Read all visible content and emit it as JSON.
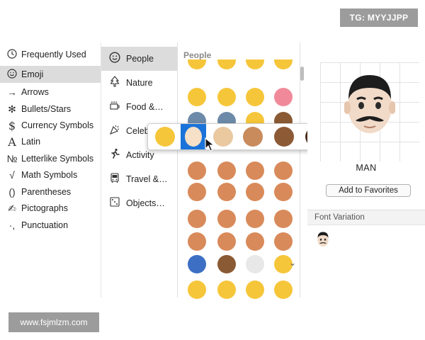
{
  "watermarks": {
    "top": "TG: MYYJJPP",
    "bottom": "www.fsjmlzm.com"
  },
  "categories": [
    {
      "label": "Frequently Used",
      "icon": "clock-icon",
      "glyph": "🕘",
      "selected": false
    },
    {
      "label": "Emoji",
      "icon": "smiley-icon",
      "glyph": "☺",
      "selected": true
    },
    {
      "label": "Arrows",
      "icon": "arrow-icon",
      "glyph": "→",
      "selected": false
    },
    {
      "label": "Bullets/Stars",
      "icon": "asterisk-icon",
      "glyph": "✻",
      "selected": false
    },
    {
      "label": "Currency Symbols",
      "icon": "dollar-icon",
      "glyph": "$",
      "selected": false
    },
    {
      "label": "Latin",
      "icon": "latin-a-icon",
      "glyph": "A",
      "selected": false
    },
    {
      "label": "Letterlike Symbols",
      "icon": "numero-icon",
      "glyph": "№",
      "selected": false
    },
    {
      "label": "Math Symbols",
      "icon": "sqrt-icon",
      "glyph": "√",
      "selected": false
    },
    {
      "label": "Parentheses",
      "icon": "parentheses-icon",
      "glyph": "()",
      "selected": false
    },
    {
      "label": "Pictographs",
      "icon": "pictograph-icon",
      "glyph": "✍",
      "selected": false
    },
    {
      "label": "Punctuation",
      "icon": "punctuation-icon",
      "glyph": "·,",
      "selected": false
    }
  ],
  "groups": [
    {
      "label": "People",
      "icon": "smiley-icon",
      "glyph": "☺",
      "selected": true
    },
    {
      "label": "Nature",
      "icon": "tree-icon",
      "glyph": "🌲",
      "selected": false
    },
    {
      "label": "Food &…",
      "icon": "food-icon",
      "glyph": "☕",
      "selected": false
    },
    {
      "label": "Celeb",
      "icon": "celebration-icon",
      "glyph": "✨",
      "selected": false
    },
    {
      "label": "Activity",
      "icon": "running-icon",
      "glyph": "🏃",
      "selected": false
    },
    {
      "label": "Travel &…",
      "icon": "bus-icon",
      "glyph": "🚌",
      "selected": false
    },
    {
      "label": "Objects…",
      "icon": "objects-icon",
      "glyph": "🎲",
      "selected": false
    }
  ],
  "grid": {
    "header": "People",
    "colors": {
      "yellow": "#f6c63a",
      "pink": "#f08a9a",
      "slate": "#6d8aa8",
      "brown": "#8a5a34",
      "family": "#d98a5a",
      "blue": "#3d6fc4",
      "white": "#e8e8e8"
    }
  },
  "popup": {
    "tones": [
      "#f6c63a",
      "#f6e0c8",
      "#eac9a1",
      "#c98a5c",
      "#8d5a36",
      "#4a2e1c"
    ],
    "selected_index": 1,
    "selected_bg": "#1a73d9"
  },
  "detail": {
    "emoji_name": "MAN",
    "favorites_button": "Add to Favorites",
    "font_variation_header": "Font Variation"
  }
}
